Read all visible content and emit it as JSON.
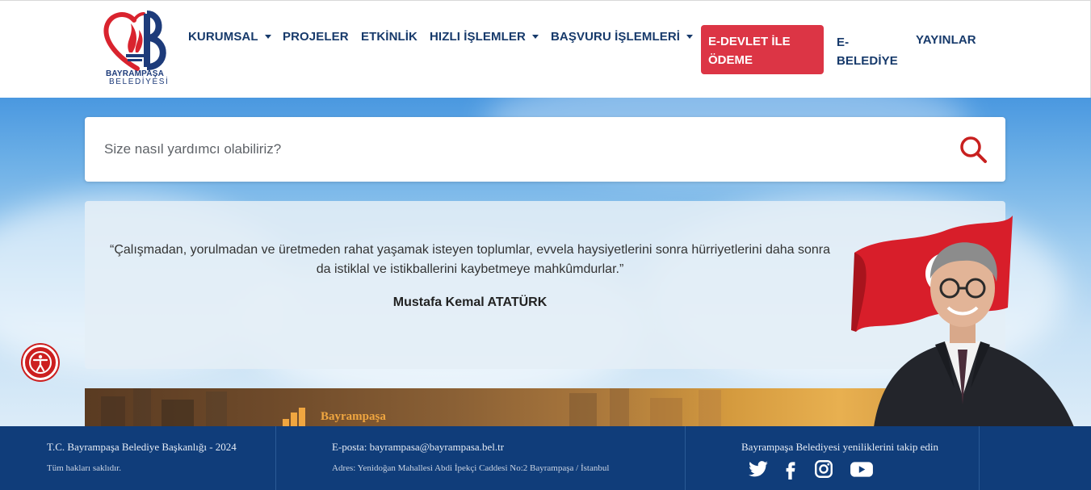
{
  "logo": {
    "line1": "BAYRAMPAŞA",
    "line2": "BELEDİYESİ"
  },
  "nav": {
    "kurumsal": "KURUMSAL",
    "projeler": "PROJELER",
    "etkinlik": "ETKİNLİK",
    "hizli": "HIZLI İŞLEMLER",
    "basvuru": "BAŞVURU İŞLEMLERİ",
    "edevlet": "E-DEVLET İLE ÖDEME",
    "ebelediye_1": "E-",
    "ebelediye_2": "BELEDİYE",
    "yayinlar": "YAYINLAR"
  },
  "search": {
    "placeholder": "Size nasıl yardımcı olabiliriz?"
  },
  "quote": {
    "text": "“Çalışmadan, yorulmadan ve üretmeden rahat yaşamak isteyen toplumlar, evvela haysiyetlerini sonra hürriyetlerini daha sonra da istiklal ve istikballerini kaybetmeye mahkûmdurlar.”",
    "author": "Mustafa Kemal ATATÜRK"
  },
  "banner": {
    "title": "Bayrampaşa"
  },
  "footer": {
    "copyright": "T.C. Bayrampaşa Belediye Başkanlığı - 2024",
    "rights": "Tüm hakları saklıdır.",
    "email": "E-posta: bayrampasa@bayrampasa.bel.tr",
    "address": "Adres: Yenidoğan Mahallesi Abdi İpekçi Caddesi No:2 Bayrampaşa / İstanbul",
    "follow": "Bayrampaşa Belediyesi yeniliklerini takip edin"
  },
  "colors": {
    "primary": "#173a6b",
    "accent": "#dc3545",
    "footer": "#103d7a"
  },
  "social_icons": [
    "twitter-icon",
    "facebook-icon",
    "instagram-icon",
    "youtube-icon"
  ]
}
